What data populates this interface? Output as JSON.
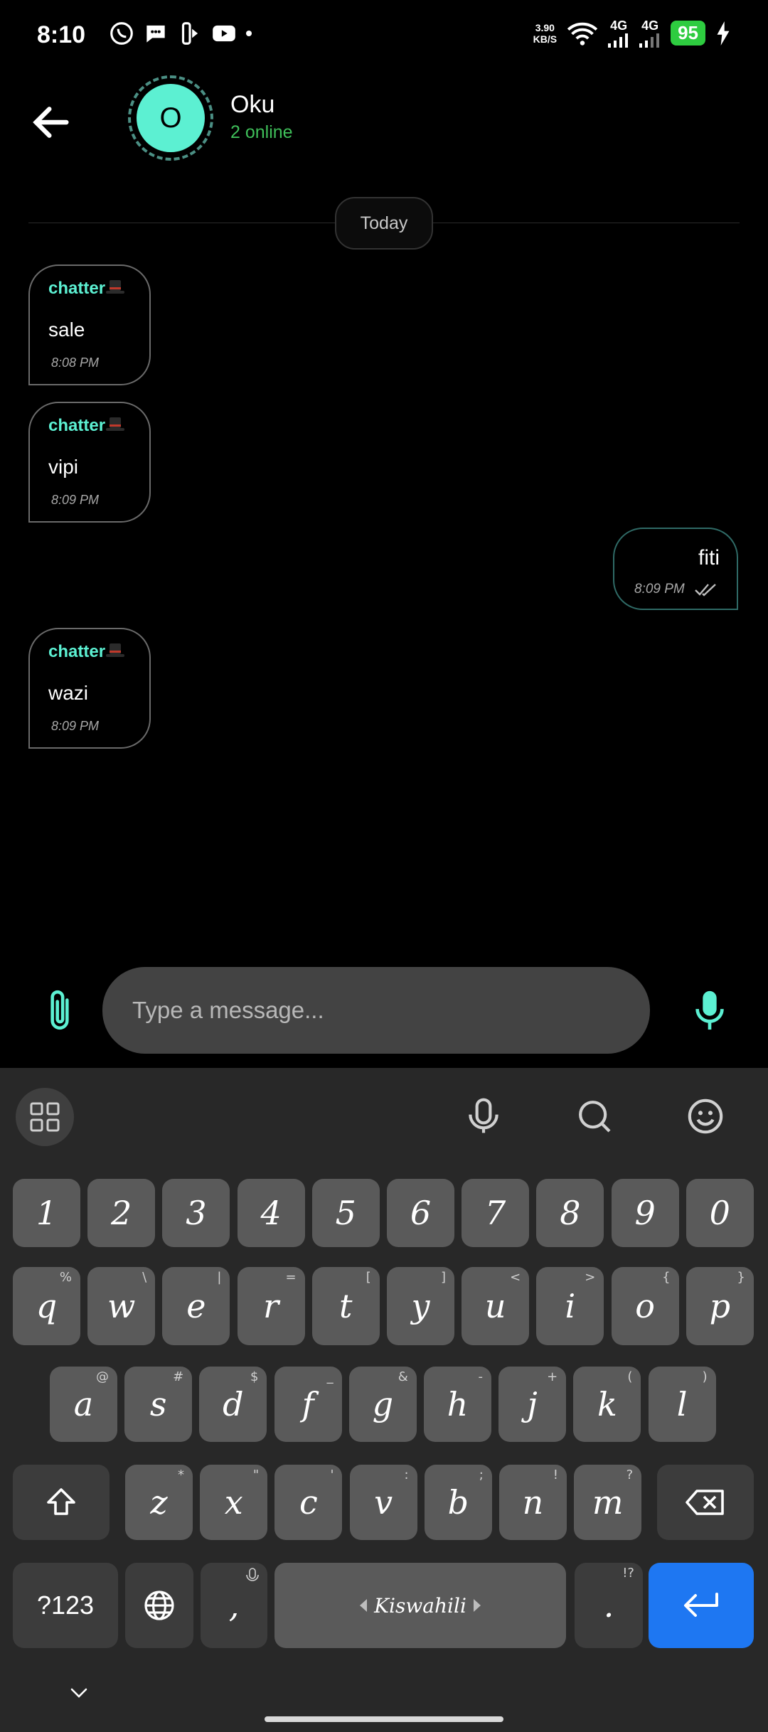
{
  "status_bar": {
    "time": "8:10",
    "net_speed_value": "3.90",
    "net_speed_unit": "KB/S",
    "network1": "4G",
    "network2": "4G",
    "battery": "95"
  },
  "header": {
    "avatar_letter": "O",
    "name": "Oku",
    "status": "2 online"
  },
  "date_divider": "Today",
  "messages": [
    {
      "sender": "chatter",
      "text": "sale",
      "time": "8:08 PM"
    },
    {
      "sender": "chatter",
      "text": "vipi",
      "time": "8:09 PM"
    },
    {
      "text": "fiti",
      "time": "8:09 PM"
    },
    {
      "sender": "chatter",
      "text": "wazi",
      "time": "8:09 PM"
    }
  ],
  "composer": {
    "placeholder": "Type a message..."
  },
  "keyboard": {
    "numbers": [
      "1",
      "2",
      "3",
      "4",
      "5",
      "6",
      "7",
      "8",
      "9",
      "0"
    ],
    "row1": [
      {
        "k": "q",
        "s": "%"
      },
      {
        "k": "w",
        "s": "\\"
      },
      {
        "k": "e",
        "s": "|"
      },
      {
        "k": "r",
        "s": "="
      },
      {
        "k": "t",
        "s": "["
      },
      {
        "k": "y",
        "s": "]"
      },
      {
        "k": "u",
        "s": "<"
      },
      {
        "k": "i",
        "s": ">"
      },
      {
        "k": "o",
        "s": "{"
      },
      {
        "k": "p",
        "s": "}"
      }
    ],
    "row2": [
      {
        "k": "a",
        "s": "@"
      },
      {
        "k": "s",
        "s": "#"
      },
      {
        "k": "d",
        "s": "$"
      },
      {
        "k": "f",
        "s": "_"
      },
      {
        "k": "g",
        "s": "&"
      },
      {
        "k": "h",
        "s": "-"
      },
      {
        "k": "j",
        "s": "+"
      },
      {
        "k": "k",
        "s": "("
      },
      {
        "k": "l",
        "s": ")"
      }
    ],
    "row3": [
      {
        "k": "z",
        "s": "*"
      },
      {
        "k": "x",
        "s": "\""
      },
      {
        "k": "c",
        "s": "'"
      },
      {
        "k": "v",
        "s": ":"
      },
      {
        "k": "b",
        "s": ";"
      },
      {
        "k": "n",
        "s": "!"
      },
      {
        "k": "m",
        "s": "?"
      }
    ],
    "symbols_key": "?123",
    "comma_key": ",",
    "space_label": "Kiswahili",
    "period_key": ".",
    "period_sup": "!?"
  },
  "colors": {
    "accent": "#5cf0d2",
    "online": "#3fbf5a",
    "enter_key": "#1e77f2",
    "battery": "#2ecc40"
  }
}
